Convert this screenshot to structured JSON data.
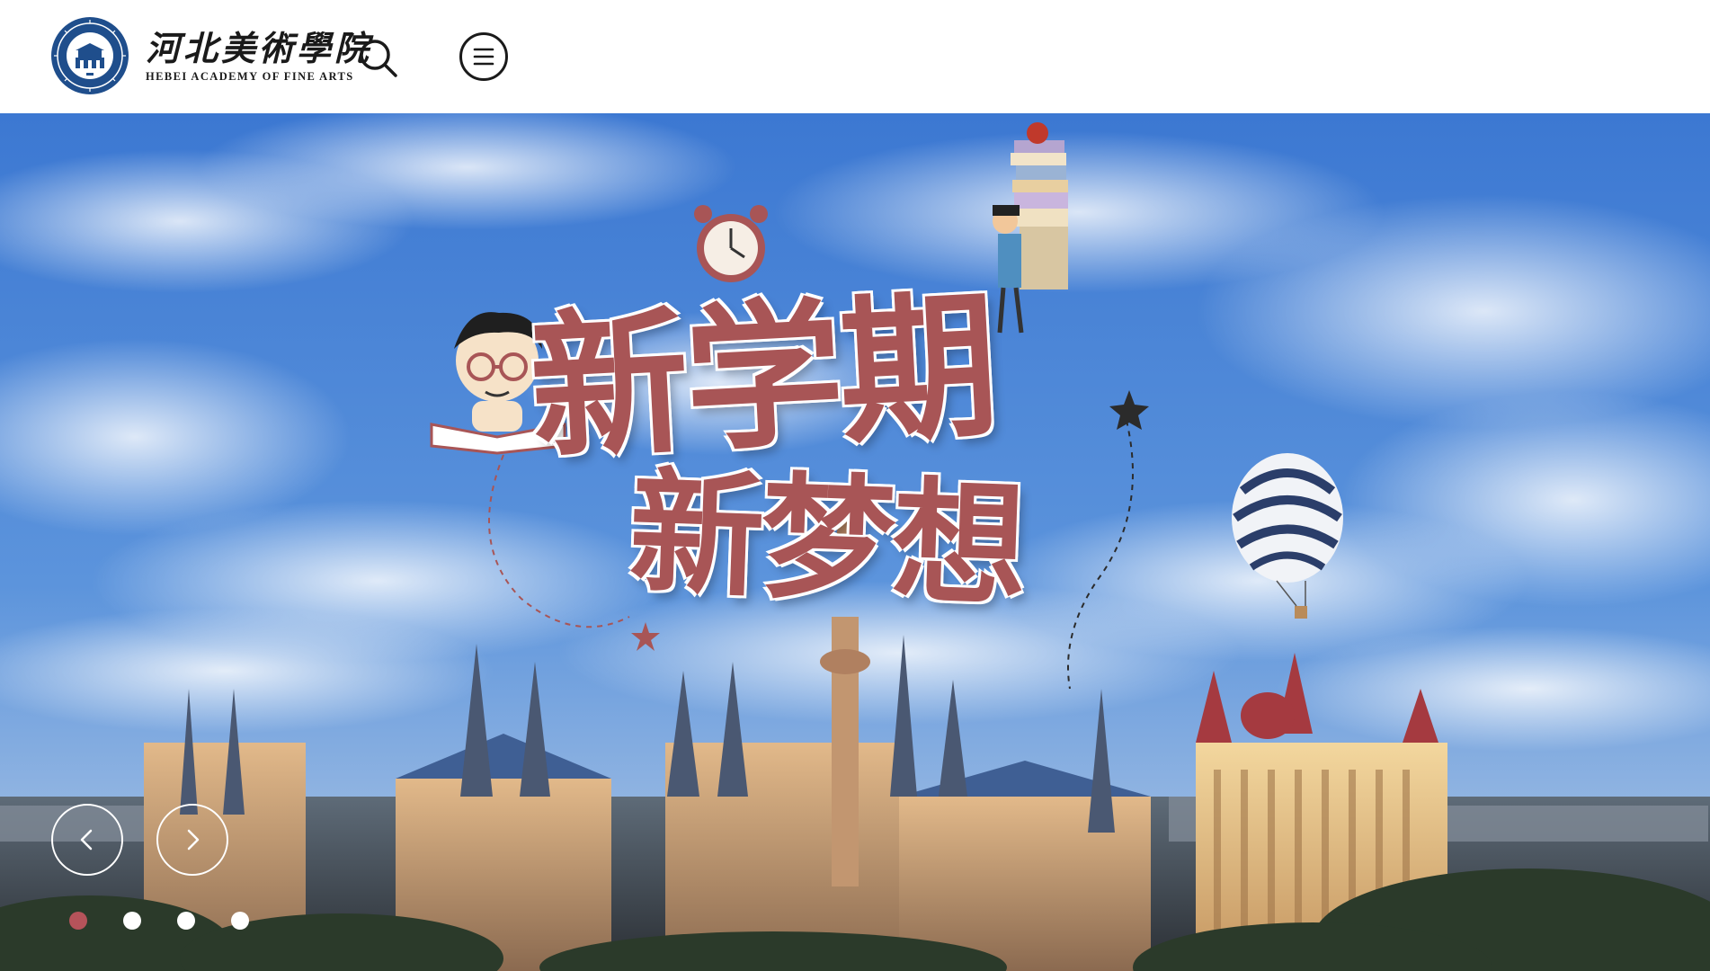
{
  "header": {
    "logo": {
      "name_cn": "河北美術學院",
      "name_en": "HEBEI ACADEMY OF  FINE ARTS",
      "seal_icon": "school-seal-icon"
    },
    "search_icon": "search-icon",
    "menu_icon": "hamburger-menu-icon"
  },
  "banner": {
    "headline_line1": "新学期",
    "headline_line2": "新梦想",
    "prev_icon": "chevron-left-icon",
    "next_icon": "chevron-right-icon",
    "slides": [
      {
        "active": true
      },
      {
        "active": false
      },
      {
        "active": false
      },
      {
        "active": false
      }
    ]
  },
  "colors": {
    "accent": "#a85556",
    "active_dot": "#b5535a",
    "seal_blue": "#1f4e8c",
    "sky": "#2f6fd0"
  }
}
